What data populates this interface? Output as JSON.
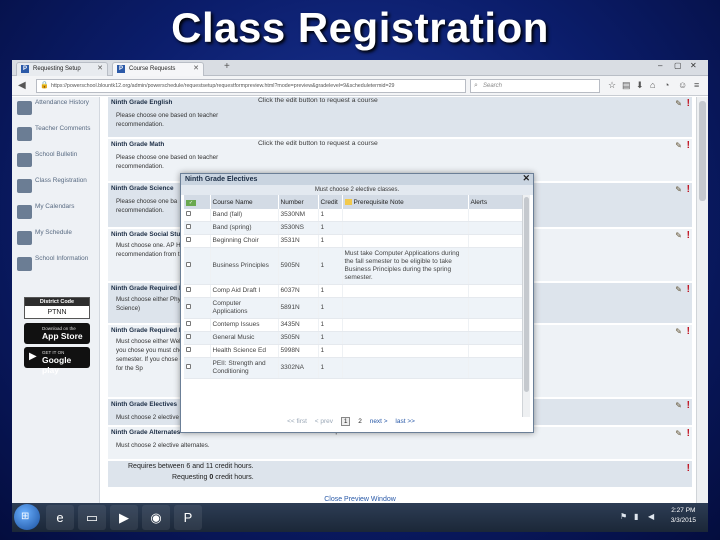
{
  "slide": {
    "title": "Class Registration"
  },
  "browser": {
    "tabs": [
      {
        "label": "Requesting Setup"
      },
      {
        "label": "Course Requests"
      }
    ],
    "url": "https://powerschool.blountk12.org/admin/powerschedule/requestsetup/requestformpreview.html?mode=preview&gradelevel=9&scheduletermid=29",
    "search_placeholder": "Search"
  },
  "sidebar": {
    "items": [
      {
        "label": "Attendance History"
      },
      {
        "label": "Teacher Comments"
      },
      {
        "label": "School Bulletin"
      },
      {
        "label": "Class Registration"
      },
      {
        "label": "My Calendars"
      },
      {
        "label": "My Schedule"
      },
      {
        "label": "School Information"
      }
    ],
    "district_code_label": "District Code",
    "district_code": "PTNN",
    "app_store_small": "Download on the",
    "app_store": "App Store",
    "google_play_small": "GET IT ON",
    "google_play": "Google play"
  },
  "requests": [
    {
      "heading": "Ninth Grade English",
      "text": "Please choose one based on teacher recommendation.",
      "message": "Click the edit button to request a course"
    },
    {
      "heading": "Ninth Grade Math",
      "text": "Please choose one based on teacher recommendation.",
      "message": "Click the edit button to request a course"
    },
    {
      "heading": "Ninth Grade Science",
      "text": "Please choose one ba recommendation.",
      "message": ""
    },
    {
      "heading": "Ninth Grade Social Studi",
      "text": "Must choose one. AP H recommendation from the teacher.",
      "message": ""
    },
    {
      "heading": "Ninth Grade Required Ele",
      "text": "Must choose either Phy (Intro to Aero. Science)",
      "message": ""
    },
    {
      "heading": "Ninth Grade Required Ele",
      "text": "Must choose either Well Science I). If you chose you must choose Welln semester. If you chose choose ROTC for the Sp",
      "message": ""
    },
    {
      "heading": "Ninth Grade Electives",
      "text": "Must choose 2 elective",
      "message": ""
    },
    {
      "heading": "Ninth Grade Alternates",
      "text": "Must choose 2 elective alternates.",
      "message": "Click the edit button to request a course"
    }
  ],
  "footer": {
    "credit_line": "Requires between 6 and 11 credit hours.",
    "requesting_prefix": "Requesting",
    "requesting_value": "0",
    "requesting_suffix": "credit hours.",
    "close_preview": "Close Preview Window"
  },
  "modal": {
    "title": "Ninth Grade Electives",
    "subtitle": "Must choose 2 elective classes.",
    "columns": {
      "course_name": "Course Name",
      "number": "Number",
      "credit": "Credit",
      "prereq": "Prerequisite Note",
      "alerts": "Alerts"
    },
    "rows": [
      {
        "name": "Band (fall)",
        "number": "3530NM",
        "credit": "1",
        "note": ""
      },
      {
        "name": "Band (spring)",
        "number": "3530NS",
        "credit": "1",
        "note": ""
      },
      {
        "name": "Beginning Choir",
        "number": "3531N",
        "credit": "1",
        "note": ""
      },
      {
        "name": "Business Principles",
        "number": "5905N",
        "credit": "1",
        "note": "Must take Computer Applications during the fall semester to be eligible to take Business Principles during the spring semester."
      },
      {
        "name": "Comp Aid Draft I",
        "number": "6037N",
        "credit": "1",
        "note": ""
      },
      {
        "name": "Computer Applications",
        "number": "5891N",
        "credit": "1",
        "note": ""
      },
      {
        "name": "Contemp Issues",
        "number": "3435N",
        "credit": "1",
        "note": ""
      },
      {
        "name": "General Music",
        "number": "3505N",
        "credit": "1",
        "note": ""
      },
      {
        "name": "Health Science Ed",
        "number": "5998N",
        "credit": "1",
        "note": ""
      },
      {
        "name": "PEII: Strength and Conditioning",
        "number": "3302NA",
        "credit": "1",
        "note": ""
      }
    ],
    "pager": {
      "first": "<< first",
      "prev": "< prev",
      "page1": "1",
      "page2": "2",
      "next": "next >",
      "last": "last >>"
    }
  },
  "taskbar": {
    "time": "2:27 PM",
    "date": "3/3/2015"
  }
}
